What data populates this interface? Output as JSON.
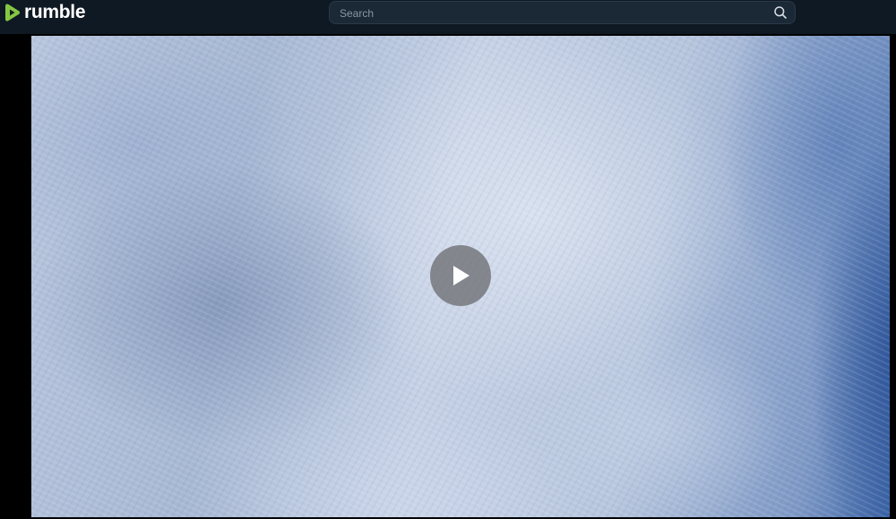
{
  "header": {
    "logo_text": "rumble",
    "search": {
      "placeholder": "Search",
      "value": ""
    },
    "icons": {
      "logo": "rumble-play-logo-icon",
      "search": "search-icon"
    }
  },
  "player": {
    "state": "paused",
    "play_icon": "play-icon"
  },
  "colors": {
    "header_bg": "#0f1923",
    "brand_green": "#85c742",
    "search_bg": "#1b2836"
  }
}
